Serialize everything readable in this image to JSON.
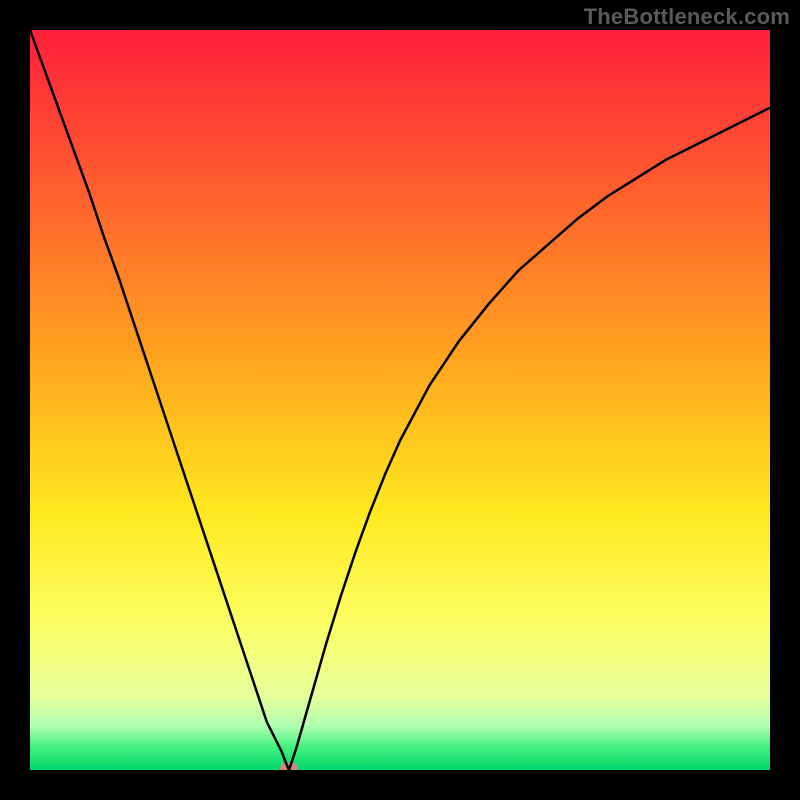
{
  "watermark": "TheBottleneck.com",
  "chart_data": {
    "type": "line",
    "title": "",
    "xlabel": "",
    "ylabel": "",
    "xlim": [
      0,
      1
    ],
    "ylim": [
      0,
      1
    ],
    "x_minimum": 0.35,
    "marker": {
      "x": 0.35,
      "y": 0.0,
      "color": "#cf8a80"
    },
    "x": [
      0.0,
      0.02,
      0.04,
      0.06,
      0.08,
      0.1,
      0.12,
      0.14,
      0.16,
      0.18,
      0.2,
      0.22,
      0.24,
      0.26,
      0.28,
      0.3,
      0.32,
      0.33,
      0.34,
      0.345,
      0.35,
      0.355,
      0.36,
      0.37,
      0.38,
      0.4,
      0.42,
      0.44,
      0.46,
      0.48,
      0.5,
      0.54,
      0.58,
      0.62,
      0.66,
      0.7,
      0.74,
      0.78,
      0.82,
      0.86,
      0.9,
      0.94,
      0.98,
      1.0
    ],
    "y": [
      1.0,
      0.945,
      0.89,
      0.835,
      0.78,
      0.72,
      0.665,
      0.605,
      0.545,
      0.485,
      0.425,
      0.365,
      0.305,
      0.245,
      0.185,
      0.125,
      0.065,
      0.045,
      0.025,
      0.012,
      0.0,
      0.015,
      0.03,
      0.065,
      0.1,
      0.17,
      0.235,
      0.295,
      0.35,
      0.4,
      0.445,
      0.52,
      0.58,
      0.63,
      0.675,
      0.71,
      0.745,
      0.775,
      0.8,
      0.825,
      0.845,
      0.865,
      0.885,
      0.895
    ],
    "gradient_stops": [
      {
        "offset": 0.0,
        "color": "#ff1f3a"
      },
      {
        "offset": 0.2,
        "color": "#ff5a2f"
      },
      {
        "offset": 0.45,
        "color": "#ffa61e"
      },
      {
        "offset": 0.65,
        "color": "#ffe81e"
      },
      {
        "offset": 0.8,
        "color": "#fcff62"
      },
      {
        "offset": 0.9,
        "color": "#e6ff9a"
      },
      {
        "offset": 0.94,
        "color": "#b1ffb1"
      },
      {
        "offset": 0.97,
        "color": "#40f07c"
      },
      {
        "offset": 1.0,
        "color": "#00d66e"
      }
    ]
  }
}
